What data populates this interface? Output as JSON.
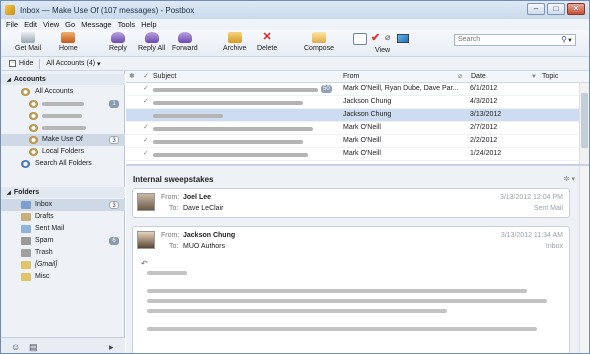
{
  "window": {
    "title": "Inbox — Make Use Of (107 messages) - Postbox",
    "buttons": [
      "–",
      "□",
      "✕"
    ]
  },
  "menu": [
    "File",
    "Edit",
    "View",
    "Go",
    "Message",
    "Tools",
    "Help"
  ],
  "toolbar": {
    "get_mail": "Get Mail",
    "home": "Home",
    "reply": "Reply",
    "reply_all": "Reply All",
    "forward": "Forward",
    "archive": "Archive",
    "delete": "Delete",
    "compose": "Compose",
    "view": "View",
    "search_placeholder": "Search",
    "search_icon": "search-icon"
  },
  "subbar": {
    "hide": "Hide",
    "accounts": "All Accounts (4)",
    "arrow": "▾"
  },
  "sidebar": {
    "accounts_header": "Accounts",
    "all_accounts": "All Accounts",
    "accounts": [
      {
        "label": "",
        "count": "1",
        "blurred": true
      },
      {
        "label": "",
        "count": "",
        "blurred": true
      },
      {
        "label": "",
        "count": "",
        "blurred": true
      },
      {
        "label": "Make Use Of",
        "count": "3",
        "blurred": false
      }
    ],
    "local_folders": "Local Folders",
    "search_all": "Search All Folders",
    "folders_header": "Folders",
    "folders": [
      {
        "label": "Inbox",
        "count": "3",
        "color": "#7c9fd1"
      },
      {
        "label": "Drafts",
        "count": "",
        "color": "#c7b07a"
      },
      {
        "label": "Sent Mail",
        "count": "",
        "color": "#8fb3d9"
      },
      {
        "label": "Spam",
        "count": "6",
        "color": "#9a9a9a"
      },
      {
        "label": "Trash",
        "count": "",
        "color": "#a0a0a0"
      },
      {
        "label": "[Gmail]",
        "count": "",
        "color": "#e2c46a"
      },
      {
        "label": "Misc",
        "count": "",
        "color": "#e2c46a"
      }
    ]
  },
  "columns": {
    "subject": "Subject",
    "from": "From",
    "date": "Date",
    "topic": "Topic"
  },
  "messages": [
    {
      "from": "Mark O'Neill, Ryan Dube, Dave Par...",
      "date": "6/1/2012",
      "badge": "50",
      "subject_width": 165
    },
    {
      "from": "Jackson Chung",
      "date": "4/3/2012",
      "badge": "",
      "subject_width": 150
    },
    {
      "from": "Jackson Chung",
      "date": "3/13/2012",
      "badge": "",
      "subject_width": 70
    },
    {
      "from": "Mark O'Neill",
      "date": "2/7/2012",
      "badge": "",
      "subject_width": 160
    },
    {
      "from": "Mark O'Neill",
      "date": "2/2/2012",
      "badge": "",
      "subject_width": 150
    },
    {
      "from": "Mark O'Neill",
      "date": "1/24/2012",
      "badge": "",
      "subject_width": 155
    }
  ],
  "reader": {
    "conversation_title": "Internal sweepstakes",
    "cards": [
      {
        "from_label": "From:",
        "from": "Joel Lee",
        "to_label": "To:",
        "to": "Dave LeClair",
        "date": "3/13/2012 12:04 PM",
        "folder": "Sent Mail"
      },
      {
        "from_label": "From:",
        "from": "Jackson Chung",
        "to_label": "To:",
        "to": "MUO Authors",
        "date": "3/13/2012 11:34 AM",
        "folder": "Inbox"
      }
    ]
  },
  "colors": {
    "selected_row": "#cddcf0",
    "accent": "#26519b"
  }
}
